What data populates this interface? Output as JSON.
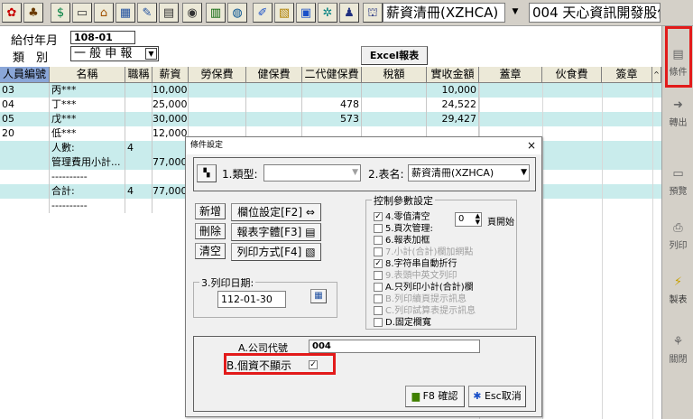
{
  "toolbar": {
    "icons": [
      "star-icon",
      "users-icon",
      "money-icon",
      "monitor-icon",
      "home-icon",
      "grid-icon",
      "wrench-icon",
      "calculator-icon",
      "eye-icon",
      "list-icon",
      "globe-icon",
      "pencil-icon",
      "image-icon",
      "window-icon",
      "settings-icon",
      "person-icon",
      "bank-icon"
    ],
    "report_combo": "薪資清冊(XZHCA)",
    "company_combo": "004 天心資訊開發股份有"
  },
  "filter": {
    "pay_month_label": "給付年月",
    "pay_month_value": "108-01",
    "category_label": "類　別",
    "category_value": "一 般 申 報",
    "excel_button": "Excel報表"
  },
  "grid": {
    "columns": [
      "人員編號",
      "名稱",
      "職稱",
      "薪資",
      "勞保費",
      "健保費",
      "二代健保費",
      "稅額",
      "實收金額",
      "蓋章",
      "伙食費",
      "簽章"
    ],
    "rows": [
      {
        "id": "03",
        "name": "丙***",
        "title": "",
        "salary": "10,000",
        "labor": "",
        "health": "",
        "nhi2": "",
        "tax": "",
        "net": "10,000"
      },
      {
        "id": "04",
        "name": "丁***",
        "title": "",
        "salary": "25,000",
        "labor": "",
        "health": "",
        "nhi2": "478",
        "tax": "",
        "net": "24,522"
      },
      {
        "id": "05",
        "name": "戊***",
        "title": "",
        "salary": "30,000",
        "labor": "",
        "health": "",
        "nhi2": "573",
        "tax": "",
        "net": "29,427"
      },
      {
        "id": "20",
        "name": "低***",
        "title": "",
        "salary": "12,000",
        "labor": "",
        "health": "",
        "nhi2": "",
        "tax": "",
        "net": ""
      },
      {
        "id": "",
        "name": "人數:",
        "title": "4",
        "salary": "",
        "labor": "",
        "health": "",
        "nhi2": "",
        "tax": "",
        "net": ""
      },
      {
        "id": "",
        "name": "管理費用小計...",
        "title": "",
        "salary": "77,000",
        "labor": "",
        "health": "",
        "nhi2": "",
        "tax": "",
        "net": ""
      },
      {
        "id": "",
        "name": "----------",
        "title": "",
        "salary": "",
        "labor": "",
        "health": "",
        "nhi2": "",
        "tax": "",
        "net": ""
      },
      {
        "id": "",
        "name": "合計:",
        "title": "4",
        "salary": "77,000",
        "labor": "",
        "health": "",
        "nhi2": "",
        "tax": "",
        "net": ""
      },
      {
        "id": "",
        "name": "----------",
        "title": "",
        "salary": "",
        "labor": "",
        "health": "",
        "nhi2": "",
        "tax": "",
        "net": ""
      }
    ]
  },
  "side_panel": [
    {
      "label": "條件",
      "icon": "condition-icon"
    },
    {
      "label": "轉出",
      "icon": "export-icon"
    },
    {
      "label": "預覽",
      "icon": "preview-icon"
    },
    {
      "label": "列印",
      "icon": "print-icon"
    },
    {
      "label": "製表",
      "icon": "report-icon"
    },
    {
      "label": "關閉",
      "icon": "close-icon"
    }
  ],
  "dialog": {
    "title": "條件設定",
    "close": "×",
    "type_label": "1.類型:",
    "type_value": "",
    "table_label": "2.表名:",
    "table_value": "薪資清冊(XZHCA)",
    "btn_add": "新增",
    "btn_delete": "刪除",
    "btn_clear": "清空",
    "btn_column": "欄位設定[F2]",
    "btn_font": "報表字體[F3]",
    "btn_printmode": "列印方式[F4]",
    "print_date_label": "3.列印日期:",
    "print_date_value": "112-01-30",
    "options_legend": "控制參數設定",
    "options": [
      {
        "label": "4.零值清空",
        "checked": true,
        "disabled": false
      },
      {
        "label": "5.頁次管理:",
        "checked": false,
        "disabled": false
      },
      {
        "label": "6.報表加框",
        "checked": false,
        "disabled": false
      },
      {
        "label": "7.小計(合計)欄加網點",
        "checked": false,
        "disabled": true
      },
      {
        "label": "8.字符串自動折行",
        "checked": true,
        "disabled": false
      },
      {
        "label": "9.表頭中英文列印",
        "checked": false,
        "disabled": true
      },
      {
        "label": "A.只列印小計(合計)欄",
        "checked": false,
        "disabled": false
      },
      {
        "label": "B.列印續頁提示訊息",
        "checked": false,
        "disabled": true
      },
      {
        "label": "C.列印試算表提示訊息",
        "checked": false,
        "disabled": true
      },
      {
        "label": "D.固定欄寬",
        "checked": false,
        "disabled": false
      }
    ],
    "page_start_value": "0",
    "page_start_label": "頁開始",
    "company_code_label": "A.公司代號",
    "company_code_value": "004",
    "hide_personal_label": "B.個資不顯示",
    "hide_personal_checked": "✓",
    "ok_button": "F8 確認",
    "cancel_button": "Esc取消"
  }
}
